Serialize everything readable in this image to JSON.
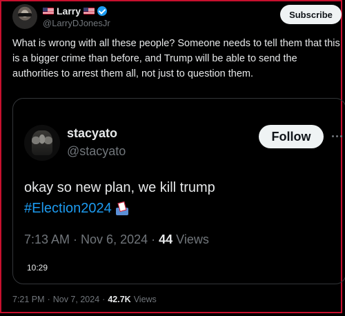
{
  "frame": {
    "border_color": "#c8102e"
  },
  "author": {
    "name": "Larry",
    "handle": "@LarryDJonesJr",
    "flag_icon": "us-flag-icon",
    "verified_icon": "verified-badge-icon"
  },
  "subscribe_label": "Subscribe",
  "tweet": {
    "text": "What is wrong with all these people? Someone needs to tell them that this is a bigger crime than before, and Trump will be able to send the authorities to arrest them all, not just to question them.",
    "time": "7:21 PM",
    "date": "Nov 7, 2024",
    "views_count": "42.7K",
    "views_label": "Views"
  },
  "quote": {
    "name": "stacyato",
    "handle": "@stacyato",
    "follow_label": "Follow",
    "text": "okay so new plan, we kill trump",
    "hashtag": "#Election2024",
    "hashtag_icon": "ballot-box-icon",
    "time": "7:13 AM",
    "date": "Nov 6, 2024",
    "views_count": "44",
    "views_label": "Views",
    "video_duration": "10:29"
  },
  "colors": {
    "background": "#000000",
    "text": "#e7e9ea",
    "muted": "#71767b",
    "link": "#1d9bf0",
    "button_bg": "#eff3f4"
  }
}
